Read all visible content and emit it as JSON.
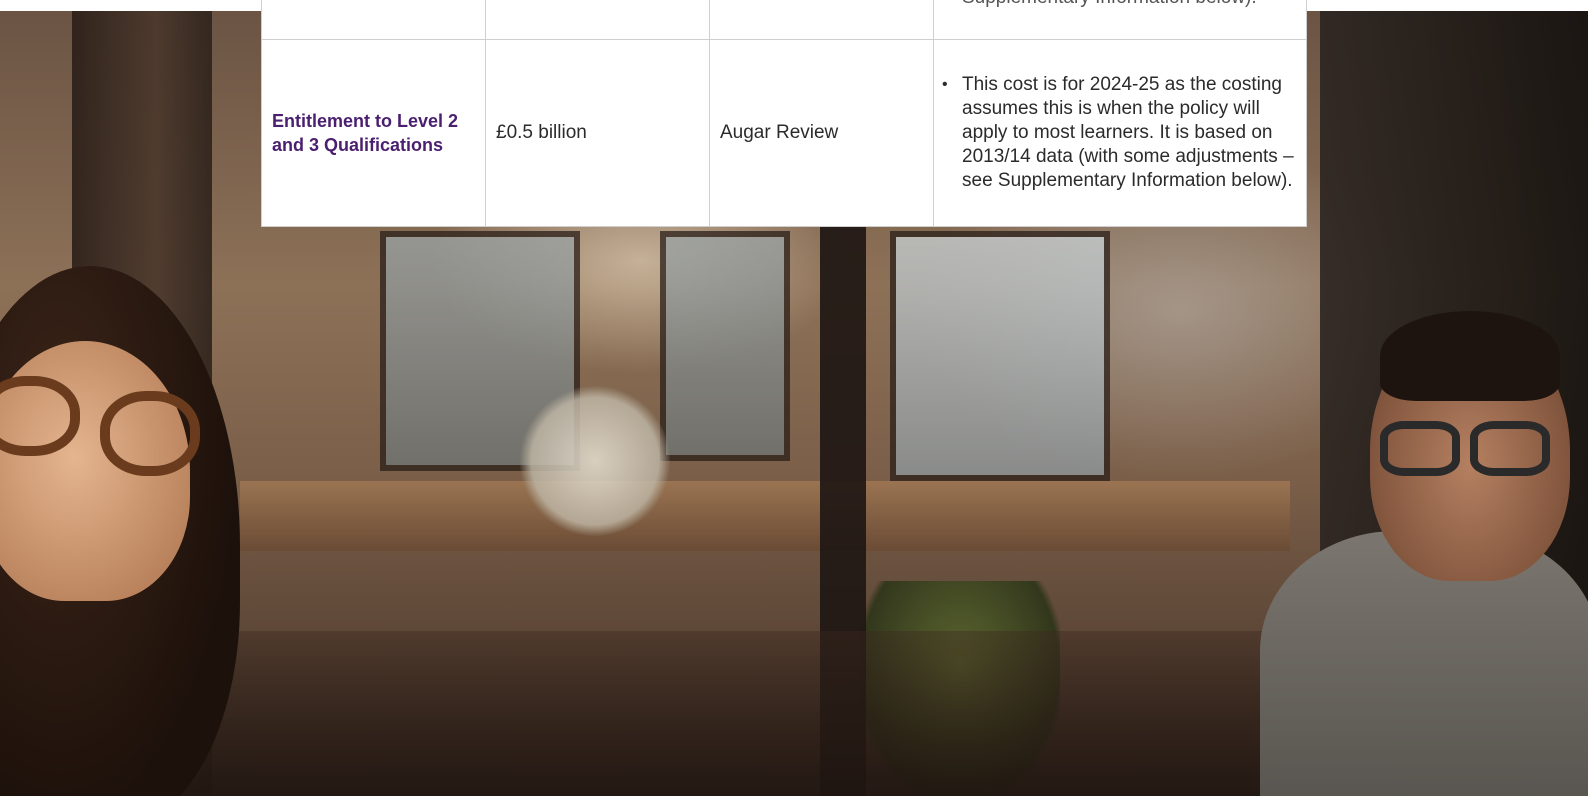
{
  "table": {
    "previous_row": {
      "notes_fragment": "Supplementary Information below)."
    },
    "row": {
      "policy": "Entitlement to Level 2 and 3 Qualifications",
      "cost": "£0.5 billion",
      "source": "Augar Review",
      "notes": [
        "This cost is for 2024-25 as the costing assumes this is when the policy will apply to most learners. It is based on 2013/14 data (with some adjustments – see Supplementary Information below)."
      ]
    }
  },
  "colors": {
    "heading_purple": "#4b1f6f",
    "table_border": "#cfcfcf",
    "body_text": "#2b2b2b"
  },
  "background_photo": {
    "description_icon": "office-photo"
  }
}
